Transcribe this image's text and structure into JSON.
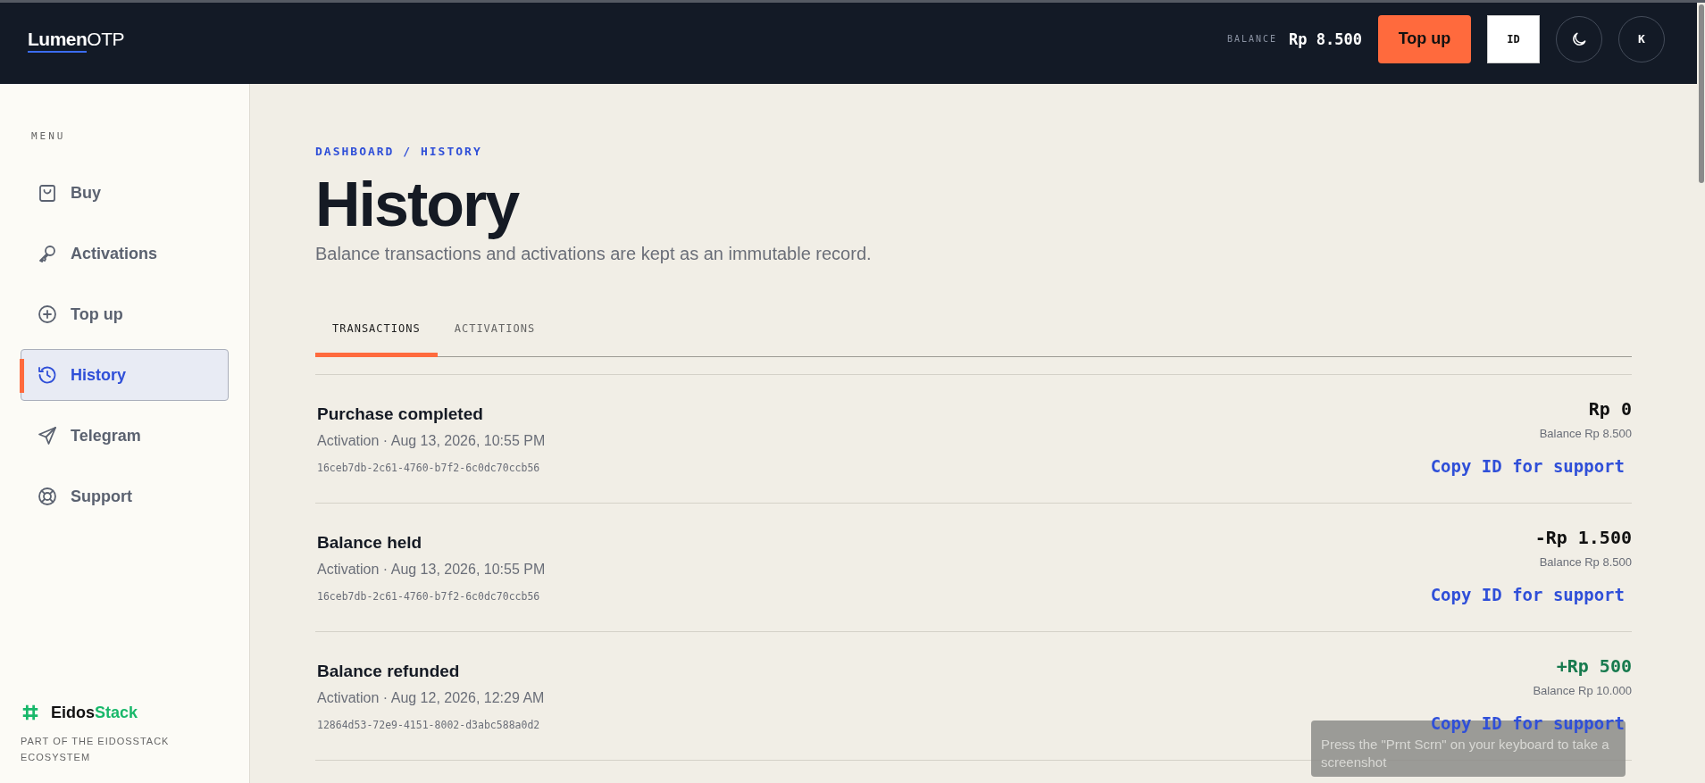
{
  "header": {
    "logo": {
      "first": "Lumen",
      "second": "OTP"
    },
    "balance_label": "BALANCE",
    "balance": "Rp 8.500",
    "top_up_button": "Top up",
    "language_button": "ID",
    "avatar": "K"
  },
  "sidebar": {
    "heading": "MENU",
    "items": [
      {
        "label": "Buy",
        "selected": false
      },
      {
        "label": "Activations",
        "selected": false
      },
      {
        "label": "Top up",
        "selected": false
      },
      {
        "label": "History",
        "selected": true
      },
      {
        "label": "Telegram",
        "selected": false
      },
      {
        "label": "Support",
        "selected": false
      }
    ],
    "footer": {
      "brand": {
        "first": "Eidos",
        "second": "Stack"
      },
      "tagline": "PART OF THE EIDOSSTACK ECOSYSTEM"
    }
  },
  "page": {
    "breadcrumb": "DASHBOARD / HISTORY",
    "title": "History",
    "subtitle": "Balance transactions and activations are kept as an immutable record.",
    "tabs": [
      {
        "label": "TRANSACTIONS",
        "selected": true
      },
      {
        "label": "ACTIVATIONS",
        "selected": false
      }
    ],
    "transactions": [
      {
        "title": "Purchase completed",
        "meta": "Activation · Aug 13, 2026, 10:55 PM",
        "id": "16ceb7db-2c61-4760-b7f2-6c0dc70ccb56",
        "amount": "Rp 0",
        "kind": "neutral",
        "balance": "Balance Rp 8.500",
        "action": "Copy ID for support"
      },
      {
        "title": "Balance held",
        "meta": "Activation · Aug 13, 2026, 10:55 PM",
        "id": "16ceb7db-2c61-4760-b7f2-6c0dc70ccb56",
        "amount": "-Rp 1.500",
        "kind": "debit",
        "balance": "Balance Rp 8.500",
        "action": "Copy ID for support"
      },
      {
        "title": "Balance refunded",
        "meta": "Activation · Aug 12, 2026, 12:29 AM",
        "id": "12864d53-72e9-4151-8002-d3abc588a0d2",
        "amount": "+Rp 500",
        "kind": "credit",
        "balance": "Balance Rp 10.000",
        "action": "Copy ID for support"
      }
    ]
  },
  "toast": {
    "message": "Press the \"Prnt Scrn\" on your keyboard to take a screenshot"
  }
}
